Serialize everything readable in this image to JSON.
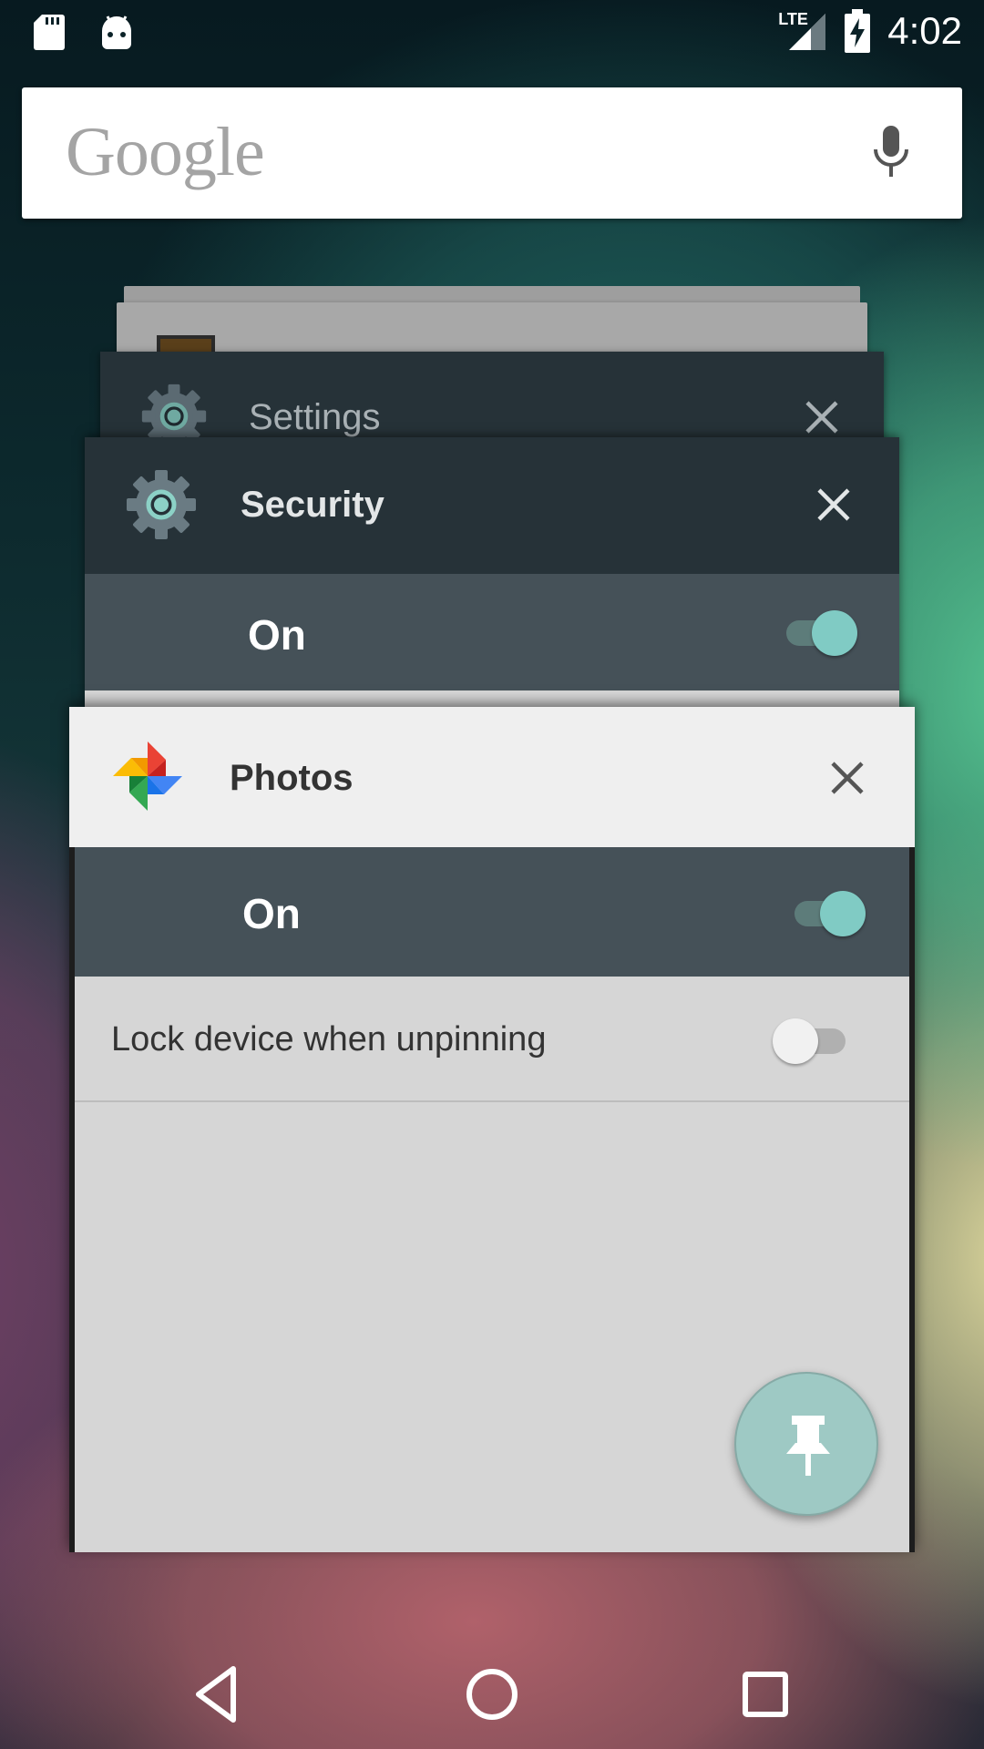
{
  "status_bar": {
    "time": "4:02",
    "network": "LTE",
    "icons": [
      "sd-card-icon",
      "android-icon",
      "lte-signal-icon",
      "battery-charging-icon"
    ]
  },
  "search": {
    "logo_text": "Google",
    "mic_icon": "mic-icon"
  },
  "recents": {
    "settings_card": {
      "title": "Settings",
      "icon": "gear-icon"
    },
    "security_card": {
      "title": "Security",
      "icon": "gear-icon",
      "row_label": "On",
      "row_toggle": "on"
    },
    "photos_card": {
      "title": "Photos",
      "icon": "photos-pinwheel-icon",
      "on_row_label": "On",
      "on_row_toggle": "on",
      "lock_row_label": "Lock device when unpinning",
      "lock_row_toggle": "off",
      "pin_button_icon": "pin-icon"
    }
  },
  "nav_bar": {
    "buttons": [
      "back-icon",
      "home-icon",
      "recents-icon"
    ]
  },
  "colors": {
    "dark_card": "#263238",
    "switch_row": "#455158",
    "accent_teal": "#80cbc4",
    "fab": "#9ec9c4"
  }
}
